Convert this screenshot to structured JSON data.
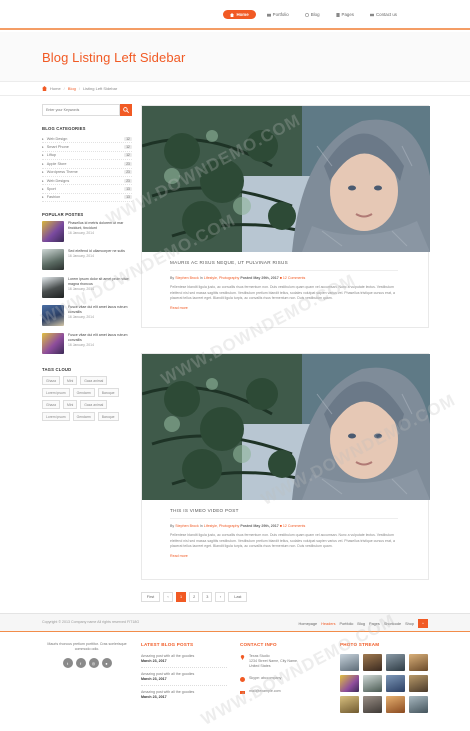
{
  "nav": {
    "items": [
      {
        "label": "Home",
        "icon": "home-icon"
      },
      {
        "label": "Portfolio",
        "icon": "portfolio-icon"
      },
      {
        "label": "Blog",
        "icon": "blog-icon"
      },
      {
        "label": "Pages",
        "icon": "pages-icon"
      },
      {
        "label": "Contact us",
        "icon": "mail-icon"
      }
    ],
    "active_index": 0
  },
  "page": {
    "title": "Blog Listing Left Sidebar"
  },
  "breadcrumb": {
    "home": "Home",
    "blog": "Blog",
    "current": "Listing Left Sidebar",
    "sep": "/"
  },
  "sidebar": {
    "search_placeholder": "Enter your Keywords",
    "categories_title": "BLOG CATEGORIES",
    "categories": [
      {
        "label": "Web Design",
        "count": "12"
      },
      {
        "label": "Smart Phone",
        "count": "12"
      },
      {
        "label": "Liftup",
        "count": "12"
      },
      {
        "label": "Apple Store",
        "count": "23"
      },
      {
        "label": "Wordpress Theme",
        "count": "23"
      },
      {
        "label": "Web Designs",
        "count": "23"
      },
      {
        "label": "Sport",
        "count": "13"
      },
      {
        "label": "Fashion",
        "count": "13"
      }
    ],
    "popular_title": "POPULAR POSTES",
    "popular": [
      {
        "title": "Phasellus id metris dolorem ut mar tincidunt, tincidunt",
        "date": "16 January, 2014"
      },
      {
        "title": "Sed eleifend id ullamcorper ne sutis",
        "date": "16 January, 2014"
      },
      {
        "title": "Lorem ipsum dolor sit amet proin vitae magna rhoncus",
        "date": "16 January, 2014"
      },
      {
        "title": "Fusce vitae dui elit amet lacus rutrum convallis",
        "date": "16 January, 2014"
      },
      {
        "title": "Fusce vitae dui elit amet lacus rutrum convallis",
        "date": "16 January, 2014"
      }
    ],
    "tags_title": "TAGS CLOUD",
    "tags": [
      "Ghaza",
      "Mini",
      "Gaza animal",
      "Lorem ipsum",
      "Gendarm",
      "Baroque",
      "Ghaza",
      "Mini",
      "Gaza animal",
      "Lorem ipsum",
      "Gendarm",
      "Baroque"
    ]
  },
  "posts": [
    {
      "title": "MAURIS AC RISUS NEQUE, UT PULVINAR RISUS",
      "by": "By",
      "author": "Stephen Brock",
      "in": "In",
      "category": "Lifestyle, Photography",
      "posted": "Posted",
      "date": "May 29th, 2017",
      "comments": "12 Comments",
      "excerpt": "Pellentese blandit ligula justo, ac convallis risus fermentum non. Duis vestibulum quam quam vel accumsan. Nunc a vulputate lectus. Vestibulum eleifend nisl sed massa sagittis vestibulum. Vestibulum pretium blandit tellus, sodales volutpat sapien varius vel. Phasellus tristique cursus erat, a placerat tellus laoreet eget. Blandit ligula turpis, ac convallis risus fermentum non. Duis vestibulum quam.",
      "read_more": "Read more"
    },
    {
      "title": "THIS IS VIMEO VIDEO POST",
      "by": "By",
      "author": "Stephen Brock",
      "in": "In",
      "category": "Lifestyle, Photography",
      "posted": "Posted",
      "date": "May 29th, 2017",
      "comments": "12 Comments",
      "excerpt": "Pellentese blandit ligula justo, ac convallis risus fermentum non. Duis vestibulum quam quam vel accumsan. Nunc a vulputate lectus. Vestibulum eleifend nisl sed massa sagittis vestibulum. Vestibulum pretium blandit tellus, sodales volutpat sapien varius vel. Phasellus tristique cursus erat, a placerat tellus laoreet eget. Blandit ligula turpis, ac convallis risus fermentum non. Duis vestibulum quam.",
      "read_more": "Read more"
    }
  ],
  "pagination": {
    "first": "First",
    "prev": "‹",
    "pages": [
      "1",
      "2",
      "3"
    ],
    "active_index": 0,
    "next": "›",
    "last": "Last"
  },
  "footer_bar": {
    "copyright": "Copyright © 2013 Company name All rights reserved FIT18G",
    "links": [
      "Homepage",
      "Headers",
      "Portfolio",
      "Blog",
      "Pages",
      "Shortcode",
      "Shop"
    ],
    "active_link_index": 1,
    "to_top": "^"
  },
  "footer": {
    "about_text": "Mauris rhoncus pretium porttitor. Cras scelerisque commodo odio.",
    "socials": [
      "twitter-icon",
      "facebook-icon",
      "dribbble-icon",
      "flickr-icon"
    ],
    "latest_title": "LATEST BLOG POSTS",
    "latest": [
      {
        "text": "Amazing post with all the goodies",
        "date": "March 23, 2017"
      },
      {
        "text": "Amazing post with all the goodies",
        "date": "March 23, 2017"
      },
      {
        "text": "Amazing post with all the goodies",
        "date": "March 23, 2017"
      }
    ],
    "contact_title": "CONTACT INFO",
    "contact": {
      "address": [
        "Texas Studio",
        "1234 Street Name, City Name,",
        "United States"
      ],
      "skype": "Skype: abccompany",
      "email": "mail@example.com"
    },
    "photos_title": "PHOTO STREAM"
  },
  "watermark": "WWW.DOWNDEMO.COM",
  "colors": {
    "accent": "#f15a24",
    "text": "#555555",
    "muted": "#999999"
  }
}
